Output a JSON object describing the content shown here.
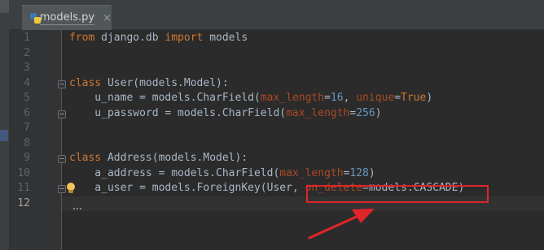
{
  "editor": {
    "tab": {
      "filename": "models.py",
      "close_glyph": "×",
      "icon": "python-file-icon"
    },
    "current_line": 12,
    "lines": [
      {
        "num": "1",
        "tokens": [
          {
            "t": "from",
            "c": "kw"
          },
          {
            "t": " django.db ",
            "c": ""
          },
          {
            "t": "import",
            "c": "kw"
          },
          {
            "t": " models",
            "c": ""
          }
        ]
      },
      {
        "num": "2",
        "tokens": []
      },
      {
        "num": "3",
        "tokens": []
      },
      {
        "num": "4",
        "tokens": [
          {
            "t": "class",
            "c": "kw"
          },
          {
            "t": " User(models.Model):",
            "c": ""
          }
        ]
      },
      {
        "num": "5",
        "tokens": [
          {
            "t": "    u_name = models.CharField(",
            "c": ""
          },
          {
            "t": "max_length",
            "c": "kwarg"
          },
          {
            "t": "=",
            "c": ""
          },
          {
            "t": "16",
            "c": "num"
          },
          {
            "t": ", ",
            "c": ""
          },
          {
            "t": "unique",
            "c": "kwarg"
          },
          {
            "t": "=",
            "c": ""
          },
          {
            "t": "True",
            "c": "kw"
          },
          {
            "t": ")",
            "c": ""
          }
        ]
      },
      {
        "num": "6",
        "tokens": [
          {
            "t": "    u_password = models.CharField(",
            "c": ""
          },
          {
            "t": "max_length",
            "c": "kwarg"
          },
          {
            "t": "=",
            "c": ""
          },
          {
            "t": "256",
            "c": "num"
          },
          {
            "t": ")",
            "c": ""
          }
        ]
      },
      {
        "num": "7",
        "tokens": []
      },
      {
        "num": "8",
        "tokens": []
      },
      {
        "num": "9",
        "tokens": [
          {
            "t": "class",
            "c": "kw"
          },
          {
            "t": " Address(models.Model):",
            "c": ""
          }
        ]
      },
      {
        "num": "10",
        "tokens": [
          {
            "t": "    a_address = models.CharField(",
            "c": ""
          },
          {
            "t": "max_length",
            "c": "kwarg"
          },
          {
            "t": "=",
            "c": ""
          },
          {
            "t": "128",
            "c": "num"
          },
          {
            "t": ")",
            "c": ""
          }
        ]
      },
      {
        "num": "11",
        "tokens": [
          {
            "t": "    a_user = models.ForeignKey(User, ",
            "c": ""
          },
          {
            "t": "on_delete",
            "c": "kwarg"
          },
          {
            "t": "=models.CASCADE)",
            "c": ""
          }
        ]
      },
      {
        "num": "12",
        "tokens": []
      }
    ]
  },
  "colors": {
    "background": "#2b2b2b",
    "keyword": "#cc7832",
    "kwarg": "#aa4926",
    "number": "#6897bb",
    "text": "#a9b7c6",
    "annotation": "#e0252a"
  }
}
